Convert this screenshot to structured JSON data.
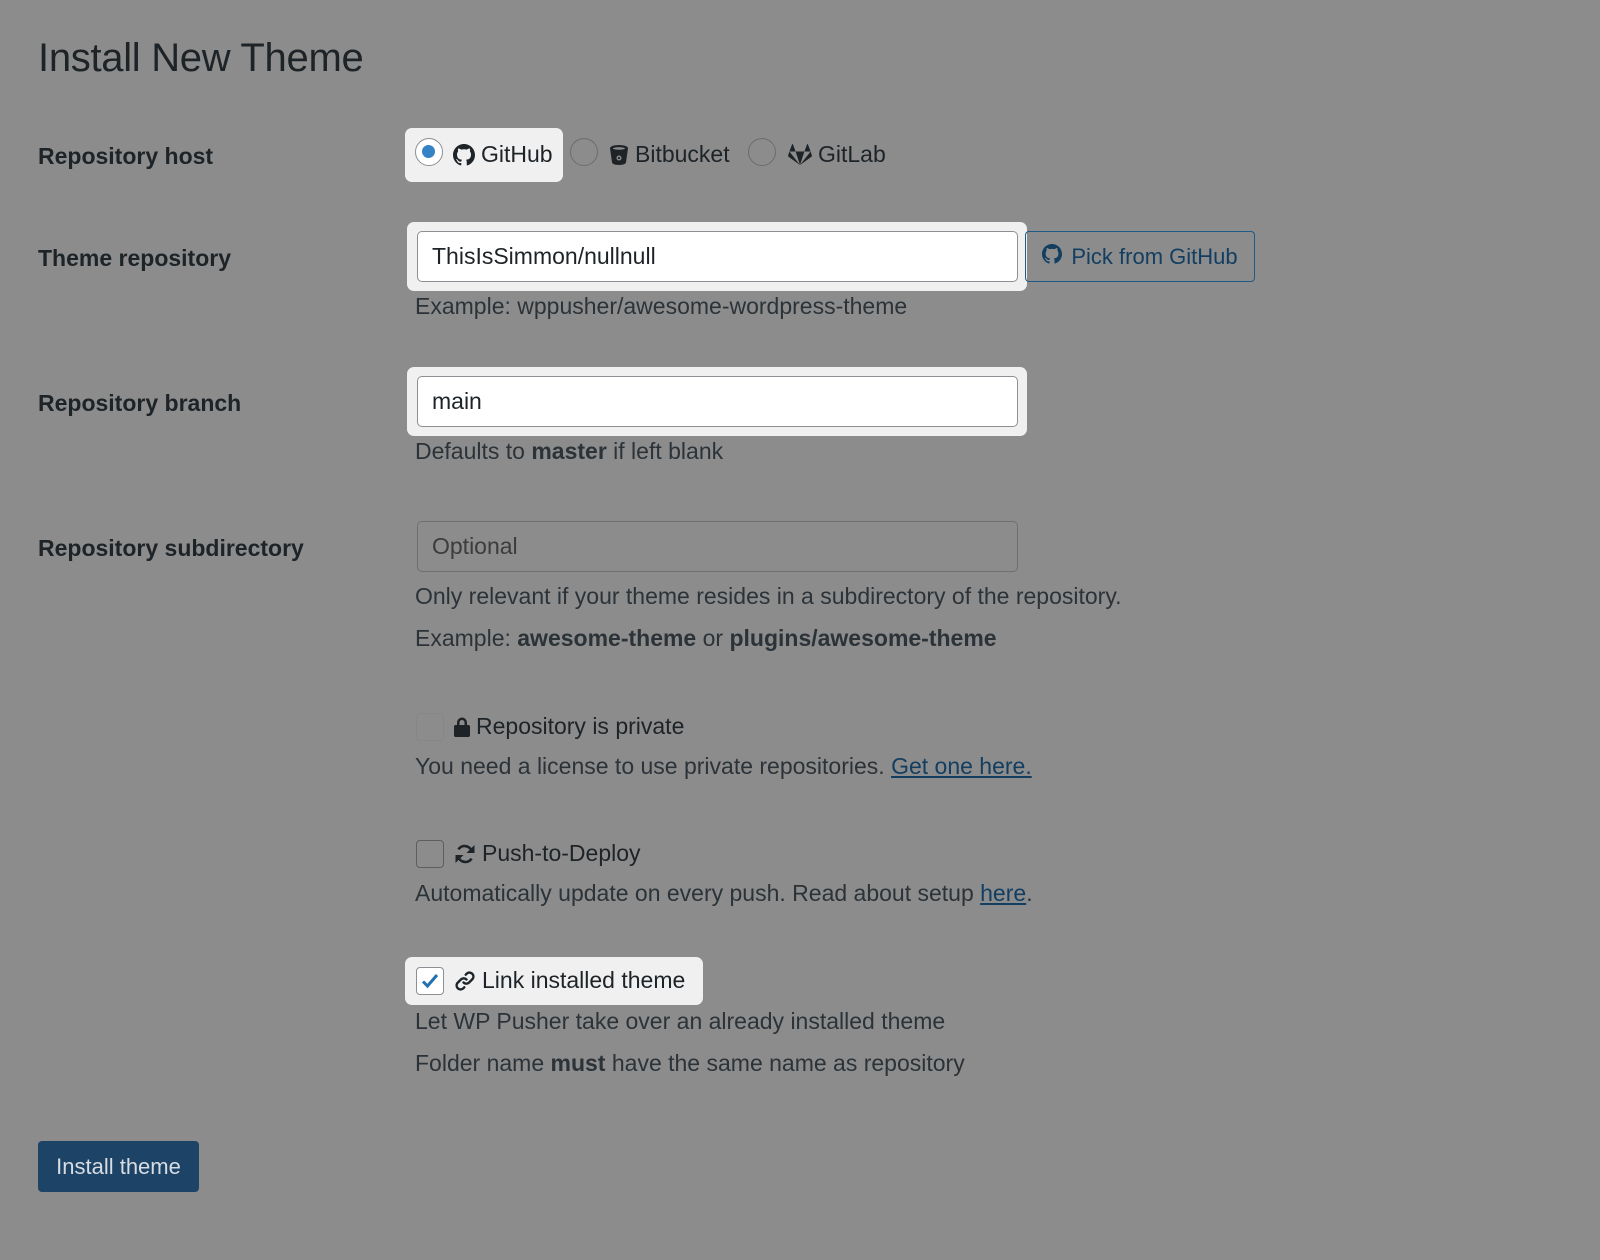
{
  "page": {
    "title": "Install New Theme"
  },
  "repository_host": {
    "label": "Repository host",
    "options": [
      {
        "label": "GitHub",
        "icon": "github-icon",
        "selected": true
      },
      {
        "label": "Bitbucket",
        "icon": "bitbucket-icon",
        "selected": false
      },
      {
        "label": "GitLab",
        "icon": "gitlab-icon",
        "selected": false
      }
    ]
  },
  "theme_repository": {
    "label": "Theme repository",
    "value": "ThisIsSimmon/nullnull",
    "pick_button_label": "Pick from GitHub",
    "hint": "Example: wppusher/awesome-wordpress-theme"
  },
  "repository_branch": {
    "label": "Repository branch",
    "value": "main",
    "hint_prefix": "Defaults to",
    "hint_bold": "master",
    "hint_suffix": "if left blank"
  },
  "repository_subdirectory": {
    "label": "Repository subdirectory",
    "placeholder": "Optional",
    "hint": "Only relevant if your theme resides in a subdirectory of the repository.",
    "example_prefix": "Example:",
    "example_1": "awesome-theme",
    "example_or": "or",
    "example_2": "plugins/awesome-theme"
  },
  "private_repo": {
    "label": "Repository is private",
    "checked": false,
    "hint": "You need a license to use private repositories.",
    "link": "Get one here."
  },
  "push_to_deploy": {
    "label": "Push-to-Deploy",
    "checked": false,
    "hint": "Automatically update on every push. Read about setup",
    "link": "here",
    "hint_end": "."
  },
  "link_installed": {
    "label": "Link installed theme",
    "checked": true,
    "hint_1": "Let WP Pusher take over an already installed theme",
    "hint_2_prefix": "Folder name",
    "hint_2_bold": "must",
    "hint_2_suffix": "have the same name as repository"
  },
  "install_button_label": "Install theme",
  "colors": {
    "background": "#8c8c8c",
    "accent": "#3582c4",
    "primary_button": "#1d4366",
    "link": "#123e61",
    "spotlight": "#f0f0f1"
  }
}
